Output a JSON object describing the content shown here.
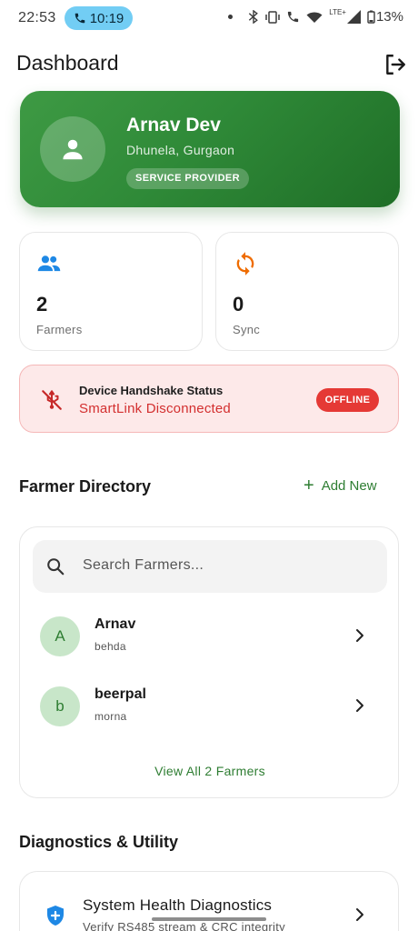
{
  "status_bar": {
    "time": "22:53",
    "call_time": "10:19",
    "battery": "13%",
    "lte": "LTE+"
  },
  "header": {
    "title": "Dashboard",
    "logout_icon": "logout-icon"
  },
  "profile": {
    "name": "Arnav Dev",
    "location": "Dhunela, Gurgaon",
    "role": "SERVICE PROVIDER",
    "avatar_icon": "person-icon",
    "gradient": [
      "#3e9a44",
      "#1f6e27"
    ]
  },
  "stats": [
    {
      "icon": "people-icon",
      "value": "2",
      "label": "Farmers",
      "color": "#1e88e5"
    },
    {
      "icon": "sync-icon",
      "value": "0",
      "label": "Sync",
      "color": "#ef6c00"
    }
  ],
  "handshake": {
    "title": "Device Handshake Status",
    "status": "SmartLink Disconnected",
    "badge": "OFFLINE",
    "icon": "usb-off-icon",
    "color": "#d32f2f"
  },
  "farmer_directory": {
    "title": "Farmer Directory",
    "add_label": "Add New",
    "search_placeholder": "Search Farmers...",
    "farmers": [
      {
        "initial": "A",
        "name": "Arnav",
        "village": "behda"
      },
      {
        "initial": "b",
        "name": "beerpal",
        "village": "morna"
      }
    ],
    "view_all": "View All 2 Farmers"
  },
  "diagnostics": {
    "title": "Diagnostics & Utility",
    "items": [
      {
        "title": "System Health Diagnostics",
        "subtitle": "Verify RS485 stream & CRC integrity",
        "icon": "shield-plus-icon"
      }
    ]
  },
  "accent": "#2e7d32"
}
